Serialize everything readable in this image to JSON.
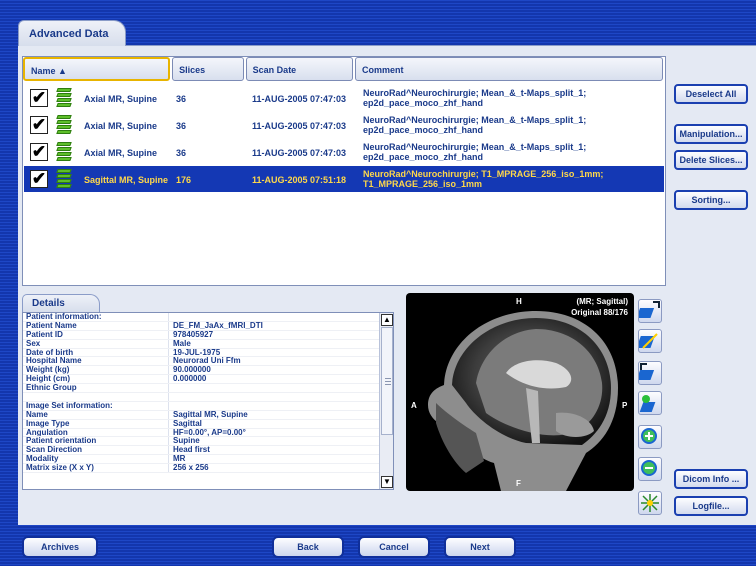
{
  "window": {
    "tab_title": "Advanced Data"
  },
  "table": {
    "columns": [
      "Name ▲",
      "Slices",
      "Scan Date",
      "Comment"
    ],
    "rows": [
      {
        "name": "Axial MR, Supine",
        "slices": "36",
        "date": "11-AUG-2005 07:47:03",
        "comment1": "NeuroRad^Neurochirurgie; Mean_&_t-Maps_split_1;",
        "comment2": "ep2d_pace_moco_zhf_hand",
        "checked": true,
        "selected": false
      },
      {
        "name": "Axial MR, Supine",
        "slices": "36",
        "date": "11-AUG-2005 07:47:03",
        "comment1": "NeuroRad^Neurochirurgie; Mean_&_t-Maps_split_1;",
        "comment2": "ep2d_pace_moco_zhf_hand",
        "checked": true,
        "selected": false
      },
      {
        "name": "Axial MR, Supine",
        "slices": "36",
        "date": "11-AUG-2005 07:47:03",
        "comment1": "NeuroRad^Neurochirurgie; Mean_&_t-Maps_split_1;",
        "comment2": "ep2d_pace_moco_zhf_hand",
        "checked": true,
        "selected": false
      },
      {
        "name": "Sagittal MR, Supine",
        "slices": "176",
        "date": "11-AUG-2005 07:51:18",
        "comment1": "NeuroRad^Neurochirurgie; T1_MPRAGE_256_iso_1mm;",
        "comment2": "T1_MPRAGE_256_iso_1mm",
        "checked": true,
        "selected": true
      }
    ]
  },
  "buttons": {
    "deselect_all": "Deselect All",
    "manipulation": "Manipulation...",
    "delete_slices": "Delete Slices...",
    "sorting": "Sorting...",
    "dicom_info": "Dicom Info ...",
    "logfile": "Logfile..."
  },
  "details": {
    "tab_label": "Details",
    "rows": [
      [
        "Patient information:",
        ""
      ],
      [
        "Patient Name",
        "DE_FM_JaAx_fMRI_DTI"
      ],
      [
        "Patient ID",
        "978405927"
      ],
      [
        "Sex",
        "Male"
      ],
      [
        "Date of birth",
        "19-JUL-1975"
      ],
      [
        "Hospital Name",
        "Neurorad Uni Ffm"
      ],
      [
        "Weight (kg)",
        "90.000000"
      ],
      [
        "Height (cm)",
        "0.000000"
      ],
      [
        "Ethnic Group",
        ""
      ],
      [
        "",
        ""
      ],
      [
        "Image Set information:",
        ""
      ],
      [
        "Name",
        "Sagittal MR, Supine"
      ],
      [
        "Image Type",
        "Sagittal"
      ],
      [
        "Angulation",
        "HF=0.00°, AP=0.00°"
      ],
      [
        "Patient orientation",
        "Supine"
      ],
      [
        "Scan Direction",
        "Head first"
      ],
      [
        "Modality",
        "MR"
      ],
      [
        "Matrix size (X x Y)",
        "256 x 256"
      ]
    ]
  },
  "viewer": {
    "top": "H",
    "bottom": "F",
    "left": "A",
    "right": "P",
    "info_line1": "(MR; Sagittal)",
    "info_line2": "Original 88/176"
  },
  "tools": [
    "rotate-left-icon",
    "flip-icon",
    "rotate-right-icon",
    "move-icon",
    "zoom-in-icon",
    "zoom-out-icon",
    "center-icon"
  ],
  "footer": {
    "archives": "Archives",
    "back": "Back",
    "cancel": "Cancel",
    "next": "Next"
  },
  "colors": {
    "selection": "#1438b4",
    "selection_text": "#ffd84a",
    "frame": "#1336ad"
  }
}
